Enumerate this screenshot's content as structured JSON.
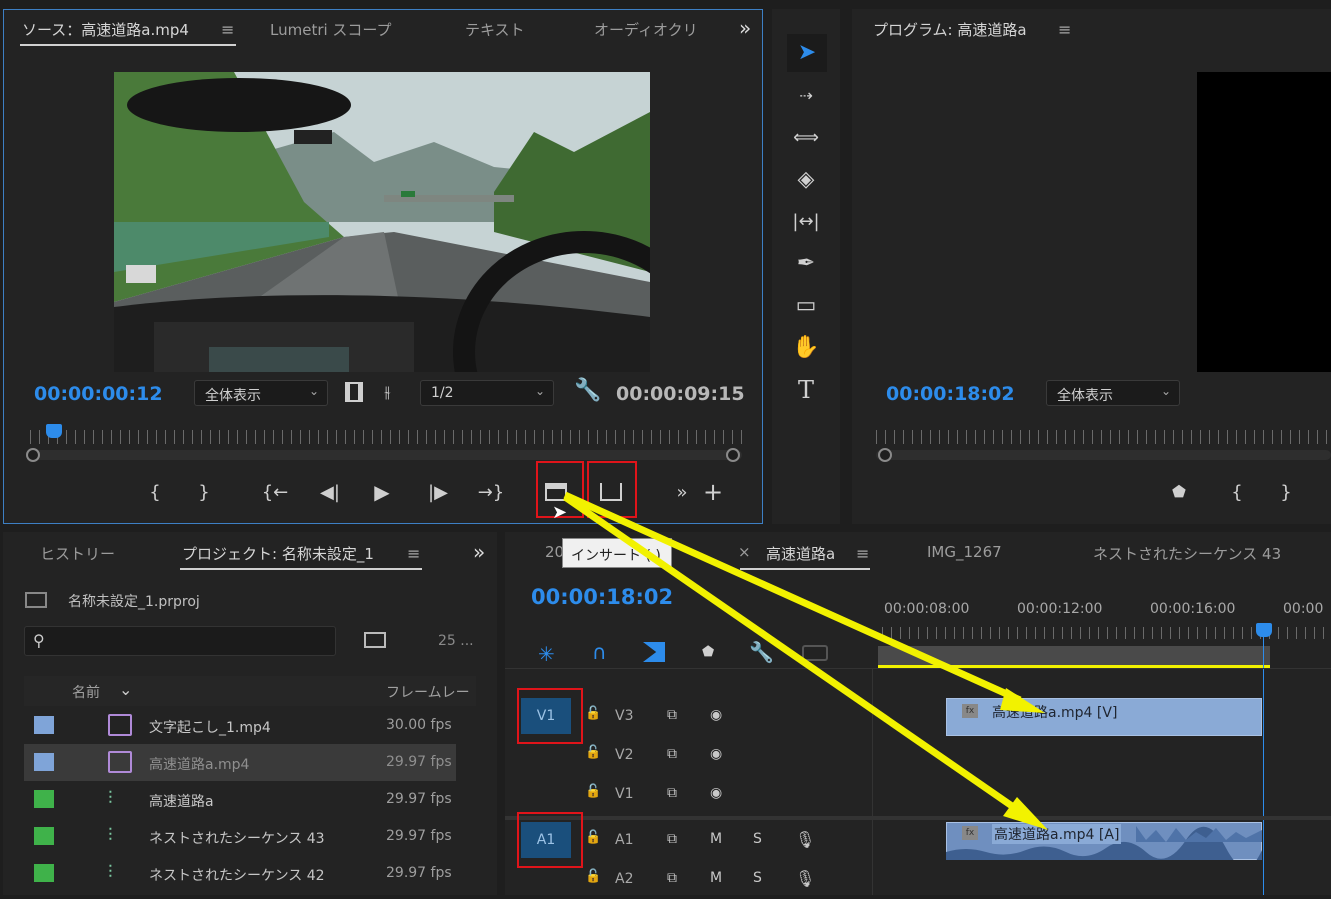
{
  "source_panel": {
    "tabs": [
      "ソース：高速道路a.mp4",
      "Lumetri スコープ",
      "テキスト",
      "オーディオクリ"
    ],
    "overflow": "»",
    "menu": "≡",
    "timecode_current": "00:00:00:12",
    "timecode_duration": "00:00:09:15",
    "zoom_select": "全体表示",
    "resolution_select": "1/2"
  },
  "program_panel": {
    "title": "プログラム: 高速道路a",
    "menu": "≡",
    "timecode_current": "00:00:18:02",
    "zoom_select": "全体表示"
  },
  "tooltip": {
    "text": "インサート (,)"
  },
  "project_panel": {
    "tabs": [
      "ヒストリー",
      "プロジェクト: 名称未設定_1"
    ],
    "menu": "≡",
    "overflow": "»",
    "project_file": "名称未設定_1.prproj",
    "item_count": "25 ...",
    "columns": {
      "name": "名前",
      "fps": "フレームレー"
    },
    "items": [
      {
        "name": "文字起こし_1.mp4",
        "fps": "30.00 fps",
        "color": "#7fa4d8",
        "type": "video"
      },
      {
        "name": "高速道路a.mp4",
        "fps": "29.97 fps",
        "color": "#7fa4d8",
        "type": "video"
      },
      {
        "name": "高速道路a",
        "fps": "29.97 fps",
        "color": "#3fb24a",
        "type": "sequence"
      },
      {
        "name": "ネストされたシーケンス 43",
        "fps": "29.97 fps",
        "color": "#3fb24a",
        "type": "sequence"
      },
      {
        "name": "ネストされたシーケンス 42",
        "fps": "29.97 fps",
        "color": "#3fb24a",
        "type": "sequence"
      }
    ]
  },
  "timeline_panel": {
    "tabs": [
      "20",
      "高速道路a",
      "IMG_1267",
      "ネストされたシーケンス 43"
    ],
    "close": "×",
    "menu": "≡",
    "timecode_current": "00:00:18:02",
    "ruler_labels": [
      "00:00:08:00",
      "00:00:12:00",
      "00:00:16:00",
      "00:00"
    ],
    "video_tracks": [
      {
        "name": "V3",
        "source": "V1"
      },
      {
        "name": "V2",
        "source": ""
      },
      {
        "name": "V1",
        "source": ""
      }
    ],
    "audio_tracks": [
      {
        "name": "A1",
        "source": "A1",
        "m": "M",
        "s": "S"
      },
      {
        "name": "A2",
        "source": "",
        "m": "M",
        "s": "S"
      }
    ],
    "clips": {
      "video": "高速道路a.mp4 [V]",
      "audio": "高速道路a.mp4 [A]",
      "fx": "fx"
    }
  },
  "tools": [
    "selection-tool",
    "track-select-tool",
    "ripple-edit-tool",
    "razor-tool",
    "slip-tool",
    "pen-tool",
    "rectangle-tool",
    "hand-tool",
    "type-tool"
  ],
  "colors": {
    "accent_blue": "#2d8ceb",
    "highlight_red": "#e0141a",
    "arrow_yellow": "#f2f200",
    "clip_blue": "#8aaad6"
  }
}
